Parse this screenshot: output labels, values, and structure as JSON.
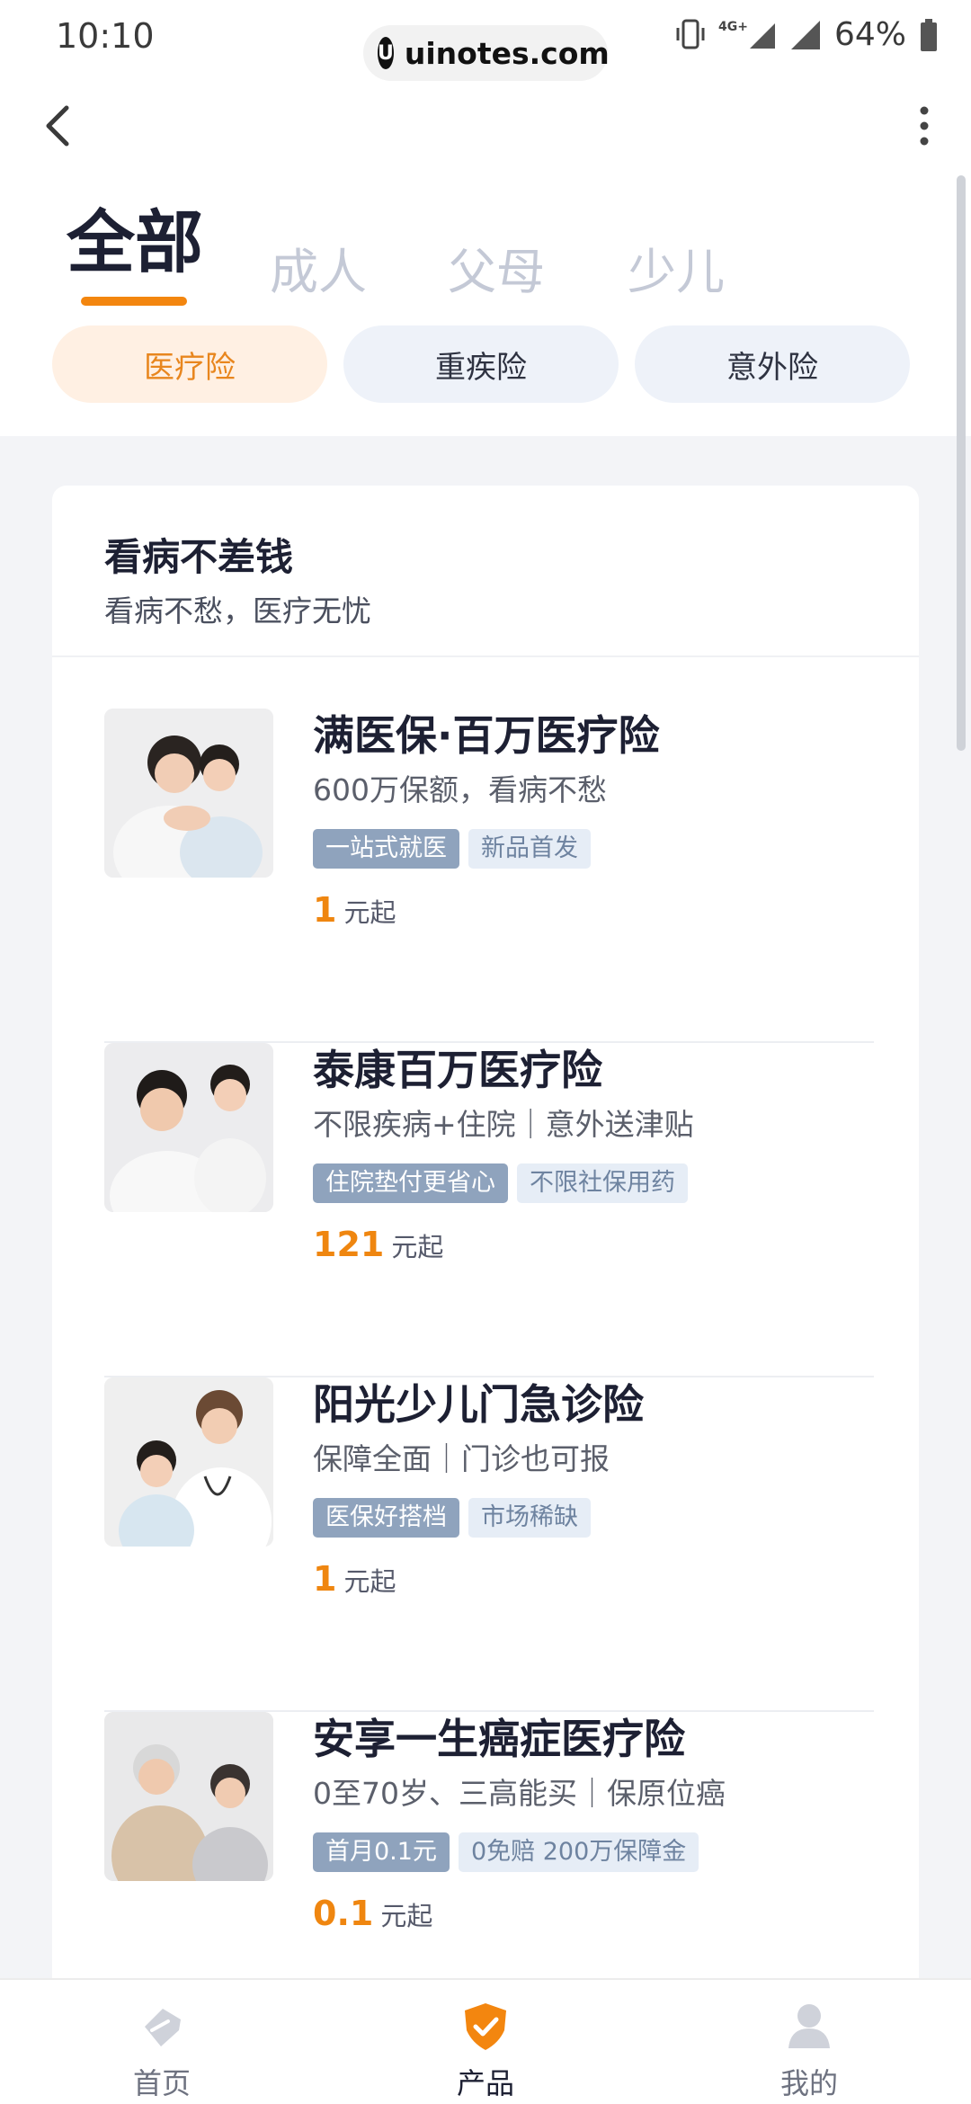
{
  "status_bar": {
    "time": "10:10",
    "url": "uinotes.com",
    "network": "4G+",
    "battery": "64%"
  },
  "tabs": [
    {
      "label": "全部",
      "active": true
    },
    {
      "label": "成人",
      "active": false
    },
    {
      "label": "父母",
      "active": false
    },
    {
      "label": "少儿",
      "active": false
    }
  ],
  "categories": [
    {
      "label": "医疗险",
      "active": true
    },
    {
      "label": "重疾险",
      "active": false
    },
    {
      "label": "意外险",
      "active": false
    }
  ],
  "section": {
    "title": "看病不差钱",
    "subtitle": "看病不愁，医疗无忧"
  },
  "products": [
    {
      "title": "满医保·百万医疗险",
      "subtitle": "600万保额，看病不愁",
      "tags": [
        "一站式就医",
        "新品首发"
      ],
      "price": "1",
      "price_unit": "元起"
    },
    {
      "title": "泰康百万医疗险",
      "subtitle": "不限疾病+住院｜意外送津贴",
      "tags": [
        "住院垫付更省心",
        "不限社保用药"
      ],
      "price": "121",
      "price_unit": "元起"
    },
    {
      "title": "阳光少儿门急诊险",
      "subtitle": "保障全面｜门诊也可报",
      "tags": [
        "医保好搭档",
        "市场稀缺"
      ],
      "price": "1",
      "price_unit": "元起"
    },
    {
      "title": "安享一生癌症医疗险",
      "subtitle": "0至70岁、三高能买｜保原位癌",
      "tags": [
        "首月0.1元",
        "0免赔 200万保障金"
      ],
      "price": "0.1",
      "price_unit": "元起"
    }
  ],
  "bottom_nav": [
    {
      "label": "首页",
      "icon": "home-tag-icon",
      "active": false
    },
    {
      "label": "产品",
      "icon": "shield-check-icon",
      "active": true
    },
    {
      "label": "我的",
      "icon": "user-icon",
      "active": false
    }
  ],
  "colors": {
    "accent": "#f3860f",
    "chip_active_bg": "#fff0e3",
    "tag_primary": "#8fa3bd",
    "tag_secondary": "#e6edf6"
  }
}
